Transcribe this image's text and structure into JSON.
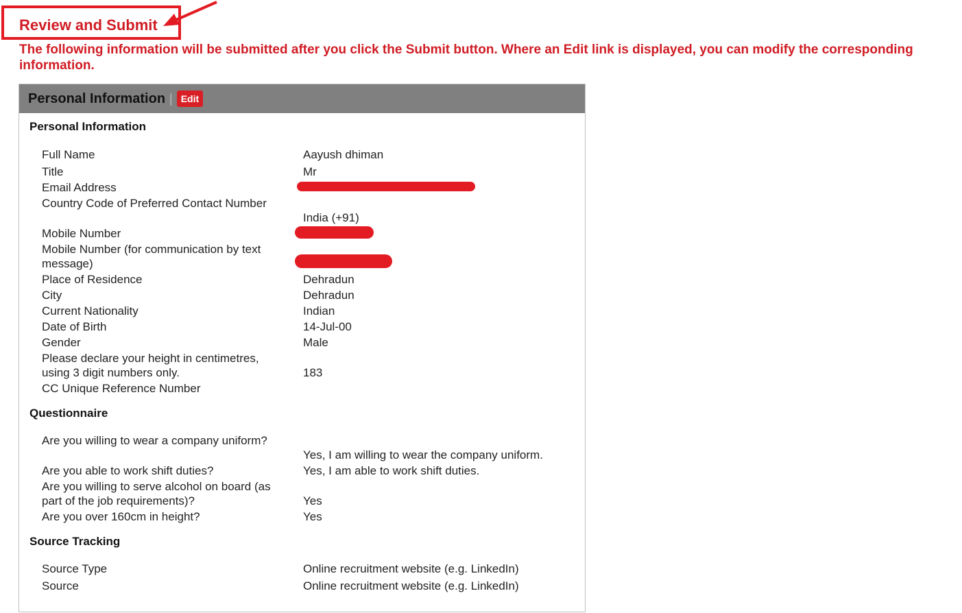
{
  "page": {
    "title": "Review and Submit",
    "intro": "The following information will be submitted after you click the Submit button. Where an Edit link is displayed, you can modify the corresponding information."
  },
  "panel": {
    "title": "Personal Information",
    "separator": "|",
    "edit_label": "Edit"
  },
  "sections": {
    "personal": {
      "title": "Personal Information",
      "rows": [
        {
          "label": "Full Name",
          "value": "Aayush dhiman"
        },
        {
          "label": "Title",
          "value": "Mr"
        },
        {
          "label": "Email Address",
          "value": ""
        },
        {
          "label": "Country Code of Preferred Contact Number",
          "value": "India (+91)"
        },
        {
          "label": "Mobile Number",
          "value": ""
        },
        {
          "label": "Mobile Number (for communication by text message)",
          "value": ""
        },
        {
          "label": "Place of Residence",
          "value": "Dehradun"
        },
        {
          "label": "City",
          "value": "Dehradun"
        },
        {
          "label": "Current Nationality",
          "value": "Indian"
        },
        {
          "label": "Date of Birth",
          "value": "14-Jul-00"
        },
        {
          "label": "Gender",
          "value": "Male"
        },
        {
          "label": "Please declare your height in centimetres, using 3 digit numbers only.",
          "value": "183"
        },
        {
          "label": "CC Unique Reference Number",
          "value": ""
        }
      ]
    },
    "questionnaire": {
      "title": "Questionnaire",
      "rows": [
        {
          "label": "Are you willing to wear a company uniform?",
          "value": "Yes, I am willing to wear the company uniform."
        },
        {
          "label": "Are you able to work shift duties?",
          "value": "Yes, I am able to work shift duties."
        },
        {
          "label": "Are you willing to serve alcohol on board (as part of the job requirements)?",
          "value": "Yes"
        },
        {
          "label": "Are you over 160cm in height?",
          "value": "Yes"
        }
      ]
    },
    "source": {
      "title": "Source Tracking",
      "rows": [
        {
          "label": "Source Type",
          "value": "Online recruitment website (e.g. LinkedIn)"
        },
        {
          "label": "Source",
          "value": "Online recruitment website (e.g. LinkedIn)"
        }
      ]
    }
  }
}
